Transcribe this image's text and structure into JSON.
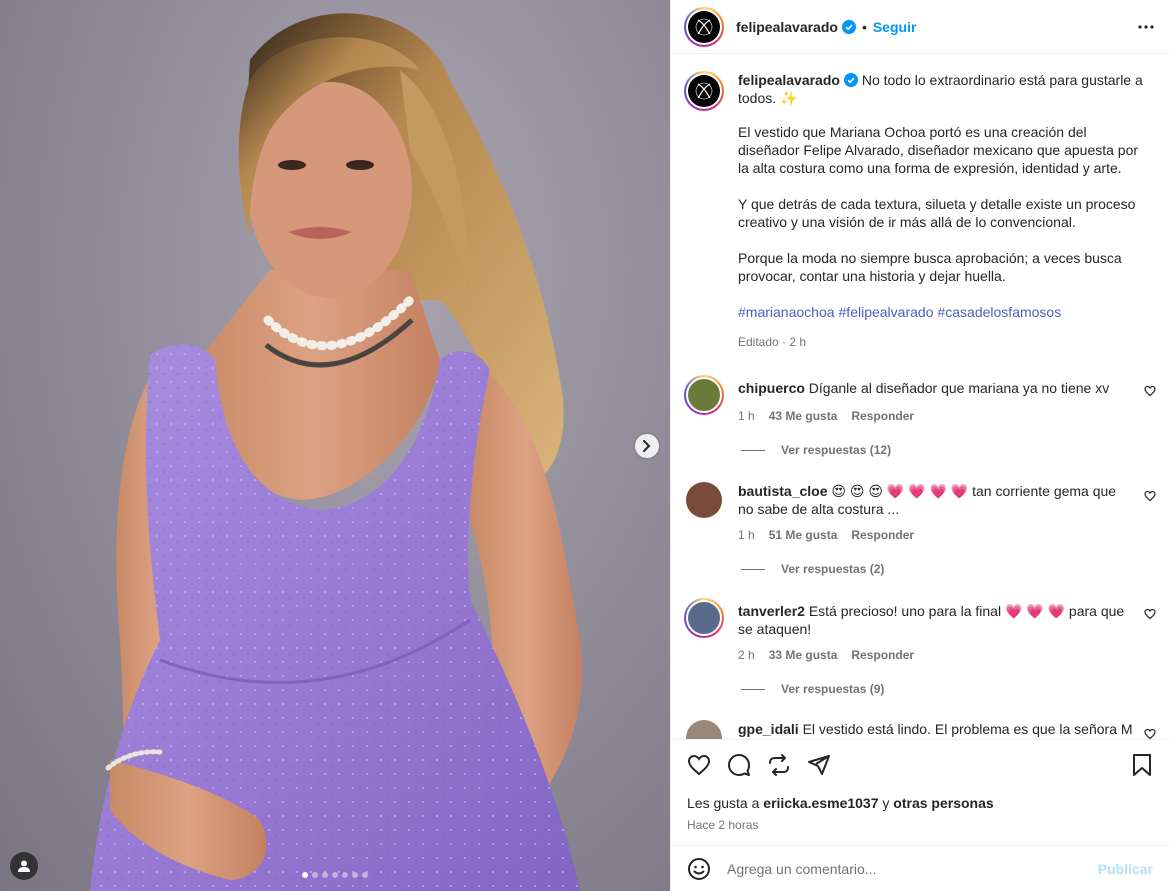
{
  "header": {
    "username": "felipealavarado",
    "separator": "•",
    "follow_label": "Seguir"
  },
  "caption": {
    "username": "felipealavarado",
    "line1": "No todo lo extraordinario está para gustarle a todos. ✨",
    "para2": "El vestido que Mariana Ochoa portó es una creación del diseñador Felipe Alvarado, diseñador mexicano que apuesta por la alta costura como una forma de expresión, identidad y arte.",
    "para3": "Y que detrás de cada textura, silueta y detalle existe un proceso creativo y una visión de ir más allá de lo convencional.",
    "para4": "Porque la moda no siempre busca aprobación; a veces busca provocar, contar una historia y dejar huella.",
    "hashtags": [
      "#marianaochoa",
      "#felipealvarado",
      "#casadelosfamosos"
    ],
    "meta": "Editado · 2 h"
  },
  "comments": [
    {
      "username": "chipuerco",
      "text": "Díganle al diseñador que mariana ya no tiene xv",
      "time": "1 h",
      "likes": "43 Me gusta",
      "reply_label": "Responder",
      "replies": "Ver respuestas (12)",
      "avatar_color": "#6b7a3a"
    },
    {
      "username": "bautista_cloe",
      "text": "😍 😍 😍 💗 💗 💗 💗 tan corriente gema que no sabe de alta costura ...",
      "time": "1 h",
      "likes": "51 Me gusta",
      "reply_label": "Responder",
      "replies": "Ver respuestas (2)",
      "avatar_color": "#7a4a3a"
    },
    {
      "username": "tanverler2",
      "text": "Está precioso! uno para la final 💗 💗 💗  para que se ataquen!",
      "time": "2 h",
      "likes": "33 Me gusta",
      "reply_label": "Responder",
      "replies": "Ver respuestas (9)",
      "avatar_color": "#5a6a8a"
    },
    {
      "username": "gpe_idali",
      "text": "El vestido está lindo. El problema es que la señora M se ve X con el puesto. No tiene porte y se le veía grande. No",
      "avatar_color": "#9a8878"
    }
  ],
  "likes_line": {
    "prefix": "Les gusta a",
    "user": "eriicka.esme1037",
    "middle": "y",
    "others": "otras personas"
  },
  "time_ago": "Hace 2 horas",
  "composer": {
    "placeholder": "Agrega un comentario...",
    "publish_label": "Publicar"
  },
  "carousel": {
    "count": 7,
    "active_index": 0
  },
  "icons": [
    "verified-icon",
    "more-icon",
    "next-arrow-icon",
    "tagged-user-icon",
    "heart-icon",
    "comment-icon",
    "share-icon",
    "send-icon",
    "bookmark-icon",
    "emoji-icon"
  ],
  "colors": {
    "accent": "#0095f6",
    "hashtag": "#4a5fc1",
    "muted": "#737373",
    "publish_disabled": "#b2dffc",
    "dress": "#9b7fd4"
  }
}
